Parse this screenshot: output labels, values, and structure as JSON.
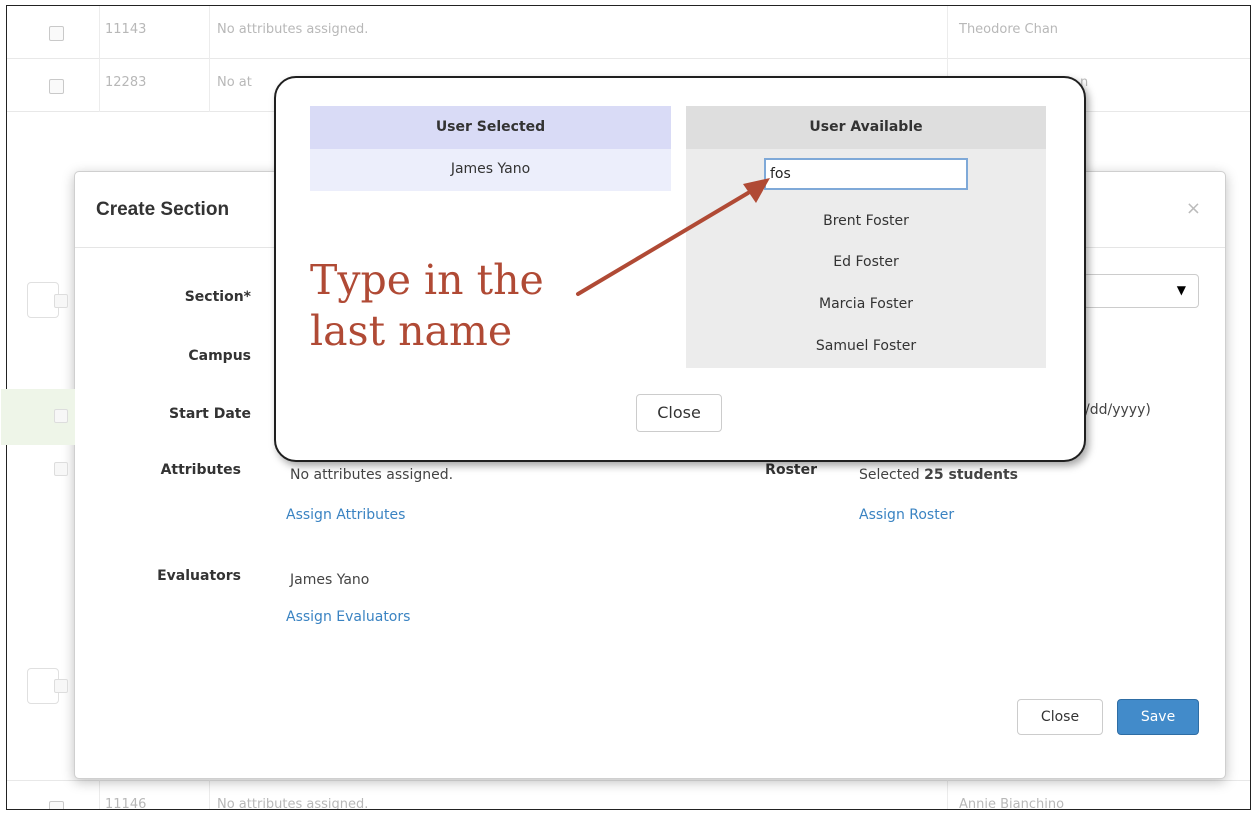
{
  "background_rows": [
    {
      "id": "11143",
      "attributes": "No attributes assigned.",
      "evaluator": "Theodore Chan"
    },
    {
      "id": "12283",
      "attributes": "No at",
      "evaluator": "n"
    },
    {
      "id": "11146",
      "attributes": "No attributes assigned.",
      "evaluator": "Annie Bianchino"
    }
  ],
  "modal": {
    "title": "Create Section",
    "close_icon": "×",
    "section_label": "Section*",
    "campus_label": "Campus",
    "start_date_label": "Start Date",
    "date_format_hint": "/dd/yyyy)",
    "attributes_label": "Attributes",
    "attributes_value": "No attributes assigned.",
    "assign_attributes_link": "Assign Attributes",
    "roster_label": "Roster",
    "roster_prefix": "Selected",
    "roster_count": "25 students",
    "assign_roster_link": "Assign Roster",
    "evaluators_label": "Evaluators",
    "evaluators_value": "James Yano",
    "assign_evaluators_link": "Assign Evaluators",
    "close_button": "Close",
    "save_button": "Save",
    "select_caret": "▼"
  },
  "popup": {
    "selected_header": "User Selected",
    "selected_users": [
      "James Yano"
    ],
    "available_header": "User Available",
    "search_value": "fos",
    "available_users": [
      "Brent Foster",
      "Ed Foster",
      "Marcia Foster",
      "Samuel Foster"
    ],
    "close_button": "Close"
  },
  "annotation": {
    "line1": "Type in the",
    "line2": "last name",
    "color": "#b04a35"
  },
  "colors": {
    "primary": "#428bca",
    "link": "#3a83c2",
    "selected_header_bg": "#d9dbf6",
    "available_bg": "#ececec"
  }
}
